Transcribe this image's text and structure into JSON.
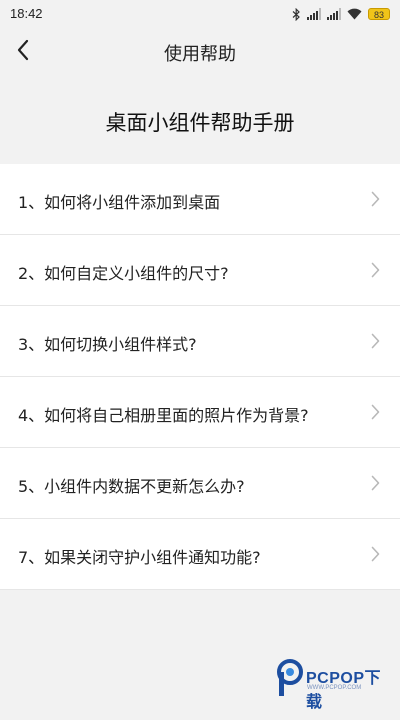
{
  "status_bar": {
    "time": "18:42",
    "battery": "83",
    "icons": [
      "bluetooth-icon",
      "signal-icon",
      "signal-icon",
      "wifi-icon",
      "battery-icon"
    ]
  },
  "header": {
    "back_icon": "chevron-left-icon",
    "title": "使用帮助"
  },
  "manual": {
    "title": "桌面小组件帮助手册"
  },
  "list": {
    "items": [
      {
        "label": "1、如何将小组件添加到桌面",
        "icon": "chevron-right-icon"
      },
      {
        "label": "2、如何自定义小组件的尺寸?",
        "icon": "chevron-right-icon"
      },
      {
        "label": "3、如何切换小组件样式?",
        "icon": "chevron-right-icon"
      },
      {
        "label": "4、如何将自己相册里面的照片作为背景?",
        "icon": "chevron-right-icon"
      },
      {
        "label": "5、小组件内数据不更新怎么办?",
        "icon": "chevron-right-icon"
      },
      {
        "label": "7、如果关闭守护小组件通知功能?",
        "icon": "chevron-right-icon"
      }
    ]
  },
  "watermark": {
    "brand": "PCPOP下载",
    "sub": "WWW.PCPOP.COM"
  },
  "colors": {
    "background": "#f2f2f2",
    "list_background": "#ffffff",
    "divider": "#e6e6e6",
    "chevron": "#b8b8b8",
    "battery": "#f0c419",
    "watermark": "#1d4ea0"
  }
}
